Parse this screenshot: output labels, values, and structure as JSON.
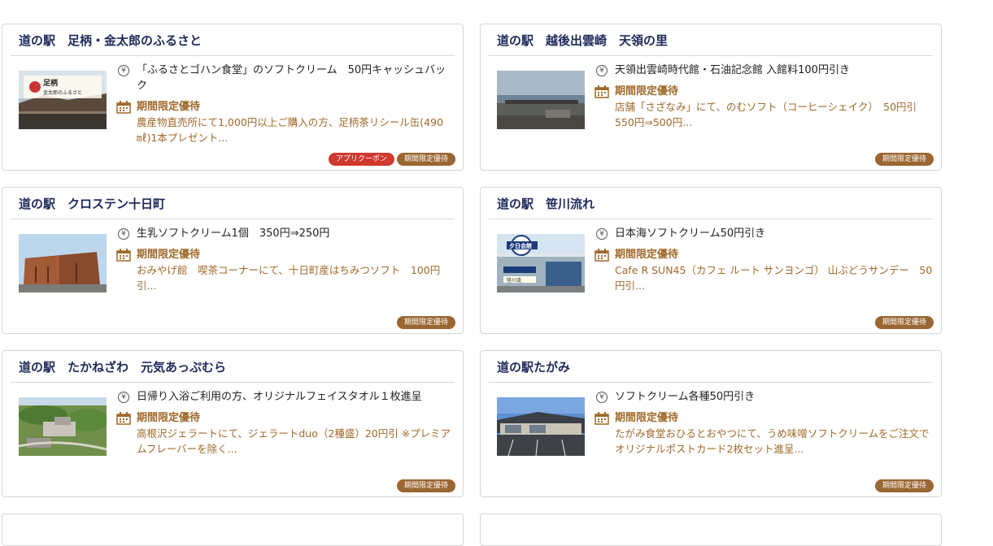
{
  "accent_colors": {
    "title": "#1d2a5a",
    "offer": "#a0692a",
    "badge_limited": "#9a6631",
    "badge_app": "#d0392f"
  },
  "cards": [
    {
      "title": "道の駅　足柄・金太郎のふるさと",
      "yen_text": "「ふるさとゴハン食堂」のソフトクリーム　50円キャッシュバック",
      "limited_label": "期間限定優待",
      "limited_text": "農産物直売所にて1,000円以上ご購入の方、足柄茶リシール缶(490㎖)1本プレゼント...",
      "badges": [
        "アプリクーポン",
        "期間限定優待"
      ],
      "thumb_logo_lines": [
        "足柄",
        "金太郎のふるさと"
      ]
    },
    {
      "title": "道の駅　越後出雲崎　天領の里",
      "yen_text": "天領出雲崎時代館・石油記念館 入館料100円引き",
      "limited_label": "期間限定優待",
      "limited_text": "店舗「さざなみ」にて、のむソフト（コーヒーシェイク）　50円引 550円⇒500円...",
      "badges": [
        "期間限定優待"
      ]
    },
    {
      "title": "道の駅　クロステン十日町",
      "yen_text": "生乳ソフトクリーム1個　350円⇒250円",
      "limited_label": "期間限定優待",
      "limited_text": "おみやげ館　喫茶コーナーにて、十日町産はちみつソフト　100円引...",
      "badges": [
        "期間限定優待"
      ]
    },
    {
      "title": "道の駅　笹川流れ",
      "yen_text": "日本海ソフトクリーム50円引き",
      "limited_label": "期間限定優待",
      "limited_text": "Cafe R SUN45（カフェ ルート サンヨンゴ） 山ぶどうサンデー　50円引...",
      "badges": [
        "期間限定優待"
      ],
      "thumb_sign_lines": [
        "夕日会館",
        "笹川流"
      ]
    },
    {
      "title": "道の駅　たかねざわ　元気あっぷむら",
      "yen_text": "日帰り入浴ご利用の方、オリジナルフェイスタオル１枚進呈",
      "limited_label": "期間限定優待",
      "limited_text": "高根沢ジェラートにて、ジェラートduo（2種盛）20円引 ※プレミアムフレーバーを除く...",
      "badges": [
        "期間限定優待"
      ]
    },
    {
      "title": "道の駅たがみ",
      "yen_text": "ソフトクリーム各種50円引き",
      "limited_label": "期間限定優待",
      "limited_text": "たがみ食堂おひるとおやつにて、うめ味噌ソフトクリームをご注文でオリジナルポストカード2枚セット進呈...",
      "badges": [
        "期間限定優待"
      ]
    }
  ],
  "icons": {
    "yen": "yen-circle-icon",
    "limited": "calendar-icon",
    "yen_glyph": "¥"
  }
}
